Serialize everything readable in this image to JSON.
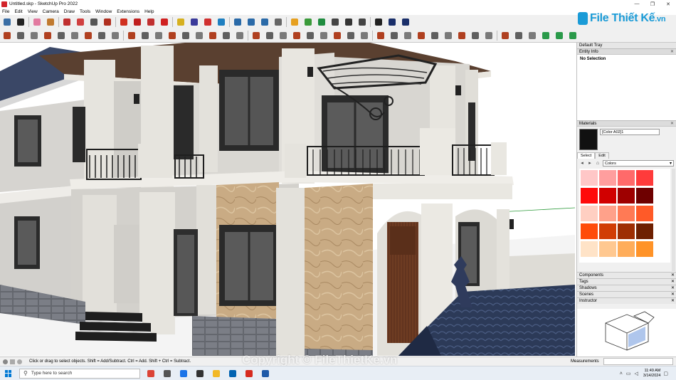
{
  "window": {
    "title": "Untitled.skp - SketchUp Pro 2022",
    "min_label": "—",
    "max_label": "❐",
    "close_label": "✕"
  },
  "menu": [
    "File",
    "Edit",
    "View",
    "Camera",
    "Draw",
    "Tools",
    "Window",
    "Extensions",
    "Help"
  ],
  "logo": {
    "brand": "File",
    "suffix": "Thiết Kế",
    "tld": ".vn"
  },
  "toolbar": {
    "row1": [
      {
        "icon": "search-icon",
        "color": "#3a6ea5"
      },
      {
        "icon": "select-arrow-icon",
        "color": "#222"
      },
      {
        "icon": "eraser-icon",
        "color": "#e27aa0"
      },
      {
        "icon": "paint-bucket-icon",
        "color": "#c07a30"
      },
      {
        "icon": "pencil-icon",
        "color": "#c03030"
      },
      {
        "icon": "arc-icon",
        "color": "#d04040"
      },
      {
        "icon": "rectangle-icon",
        "color": "#555"
      },
      {
        "icon": "push-pull-icon",
        "color": "#b03020"
      },
      {
        "icon": "move-icon",
        "color": "#d03020"
      },
      {
        "icon": "rotate-icon",
        "color": "#c02020"
      },
      {
        "icon": "scale-icon",
        "color": "#c03030"
      },
      {
        "icon": "offset-icon",
        "color": "#d02020"
      },
      {
        "icon": "tape-measure-icon",
        "color": "#d6b020"
      },
      {
        "icon": "text-icon",
        "color": "#3a3a9a"
      },
      {
        "icon": "axes-icon",
        "color": "#d03030"
      },
      {
        "icon": "orbit-icon",
        "color": "#1e7fc0"
      },
      {
        "icon": "pan-icon",
        "color": "#2a6aa8"
      },
      {
        "icon": "zoom-icon",
        "color": "#2a6aa8"
      },
      {
        "icon": "zoom-extents-icon",
        "color": "#2a6aa8"
      },
      {
        "icon": "user-icon",
        "color": "#666"
      },
      {
        "icon": "warehouse-icon",
        "color": "#e6a020"
      },
      {
        "icon": "extension-icon",
        "color": "#3a9a3a"
      },
      {
        "icon": "tree-icon",
        "color": "#1f8c3f"
      },
      {
        "icon": "checker-icon",
        "color": "#444"
      },
      {
        "icon": "upload-icon",
        "color": "#333"
      },
      {
        "icon": "settings-icon",
        "color": "#444"
      },
      {
        "icon": "mail-icon",
        "color": "#222"
      },
      {
        "icon": "info-icon",
        "color": "#1a2f6a"
      },
      {
        "icon": "account-icon",
        "color": "#1a2f6a"
      }
    ],
    "row2": [
      {
        "icon": "shape-icon-01",
        "color": "#b04020"
      },
      {
        "icon": "shape-icon-02",
        "color": "#606060"
      },
      {
        "icon": "shape-icon-03",
        "color": "#7a7a7a"
      },
      {
        "icon": "shape-icon-04",
        "color": "#b04020"
      },
      {
        "icon": "shape-icon-05",
        "color": "#606060"
      },
      {
        "icon": "shape-icon-06",
        "color": "#7a7a7a"
      },
      {
        "icon": "shape-icon-07",
        "color": "#b04020"
      },
      {
        "icon": "shape-icon-08",
        "color": "#606060"
      },
      {
        "icon": "shape-icon-09",
        "color": "#7a7a7a"
      },
      {
        "icon": "shape-icon-10",
        "color": "#b04020"
      },
      {
        "icon": "shape-icon-11",
        "color": "#606060"
      },
      {
        "icon": "shape-icon-12",
        "color": "#7a7a7a"
      },
      {
        "icon": "shape-icon-13",
        "color": "#b04020"
      },
      {
        "icon": "shape-icon-14",
        "color": "#606060"
      },
      {
        "icon": "shape-icon-15",
        "color": "#7a7a7a"
      },
      {
        "icon": "shape-icon-16",
        "color": "#b04020"
      },
      {
        "icon": "shape-icon-17",
        "color": "#606060"
      },
      {
        "icon": "shape-icon-18",
        "color": "#7a7a7a"
      },
      {
        "icon": "shape-icon-19",
        "color": "#b04020"
      },
      {
        "icon": "shape-icon-20",
        "color": "#606060"
      },
      {
        "icon": "shape-icon-21",
        "color": "#7a7a7a"
      },
      {
        "icon": "shape-icon-22",
        "color": "#b04020"
      },
      {
        "icon": "shape-icon-23",
        "color": "#606060"
      },
      {
        "icon": "shape-icon-24",
        "color": "#7a7a7a"
      },
      {
        "icon": "shape-icon-25",
        "color": "#b04020"
      },
      {
        "icon": "shape-icon-26",
        "color": "#606060"
      },
      {
        "icon": "shape-icon-27",
        "color": "#7a7a7a"
      },
      {
        "icon": "shape-icon-28",
        "color": "#b04020"
      },
      {
        "icon": "shape-icon-29",
        "color": "#606060"
      },
      {
        "icon": "shape-icon-30",
        "color": "#7a7a7a"
      },
      {
        "icon": "shape-icon-31",
        "color": "#b04020"
      },
      {
        "icon": "shape-icon-32",
        "color": "#606060"
      },
      {
        "icon": "shape-icon-33",
        "color": "#7a7a7a"
      },
      {
        "icon": "shape-icon-34",
        "color": "#b04020"
      },
      {
        "icon": "shape-icon-35",
        "color": "#606060"
      },
      {
        "icon": "shape-icon-36",
        "color": "#7a7a7a"
      },
      {
        "icon": "shape-icon-37",
        "color": "#b04020"
      },
      {
        "icon": "shape-icon-38",
        "color": "#606060"
      },
      {
        "icon": "shape-icon-39",
        "color": "#7a7a7a"
      },
      {
        "icon": "shape-icon-40",
        "color": "#2a9a4a"
      },
      {
        "icon": "shape-icon-41",
        "color": "#2a9a4a"
      },
      {
        "icon": "shape-icon-42",
        "color": "#2a9a4a"
      }
    ]
  },
  "tray": {
    "title": "Default Tray",
    "entity_info": {
      "title": "Entity Info",
      "selection": "No Selection"
    },
    "materials": {
      "title": "Materials",
      "current_name": "[Color A02]1",
      "tabs": [
        "Select",
        "Edit"
      ],
      "library": "Colors",
      "swatches": [
        "#ffc7c7",
        "#ff9e9e",
        "#ff6a6a",
        "#ff3b3b",
        "#ff0a0a",
        "#d10000",
        "#9e0000",
        "#6e0000",
        "#ffcfc2",
        "#ffa18a",
        "#ff7a55",
        "#ff5a28",
        "#ff4c0a",
        "#d13d05",
        "#9e2e03",
        "#6e2001",
        "#ffe3c7",
        "#ffc890",
        "#ffad5a",
        "#ff9328"
      ]
    },
    "collapsed_panels": [
      "Components",
      "Tags",
      "Shadows",
      "Scenes",
      "Instructor"
    ]
  },
  "status": {
    "message": "Click or drag to select objects. Shift = Add/Subtract. Ctrl = Add. Shift + Ctrl = Subtract.",
    "measurements_label": "Measurements"
  },
  "taskbar": {
    "search_placeholder": "Type here to search",
    "apps": [
      {
        "icon": "chrome-icon",
        "color": "#db4437"
      },
      {
        "icon": "settings-icon",
        "color": "#555"
      },
      {
        "icon": "browser-icon",
        "color": "#1a73e8"
      },
      {
        "icon": "media-icon",
        "color": "#333"
      },
      {
        "icon": "file-explorer-icon",
        "color": "#f2b827"
      },
      {
        "icon": "mail-icon",
        "color": "#0063b1"
      },
      {
        "icon": "acrobat-icon",
        "color": "#d62b1f"
      },
      {
        "icon": "sketchup-icon",
        "color": "#1f5aa8"
      }
    ],
    "time": "11:49 AM",
    "date": "3/14/2024"
  },
  "watermark": "Copyright © FileThietKe.vn"
}
